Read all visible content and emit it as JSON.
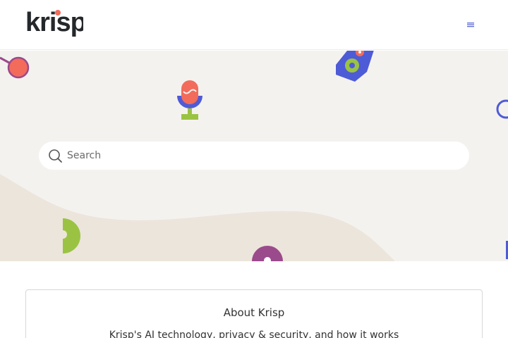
{
  "header": {
    "logo_text": "krisp",
    "menu_icon": "hamburger-icon"
  },
  "hero": {
    "search": {
      "placeholder": "Search",
      "icon": "search-icon"
    }
  },
  "categories": [
    {
      "title": "About Krisp",
      "description": "Krisp's AI technology, privacy & security, and how it works"
    }
  ],
  "colors": {
    "brand_dark": "#25282b",
    "brand_accent": "#f26b5b",
    "hero_bg": "#f4f2ef",
    "wave": "#ece5dc",
    "blue": "#4e5bd6",
    "green": "#9bc343",
    "purple": "#9b4a8c",
    "menu_icon": "#5a67d8"
  }
}
